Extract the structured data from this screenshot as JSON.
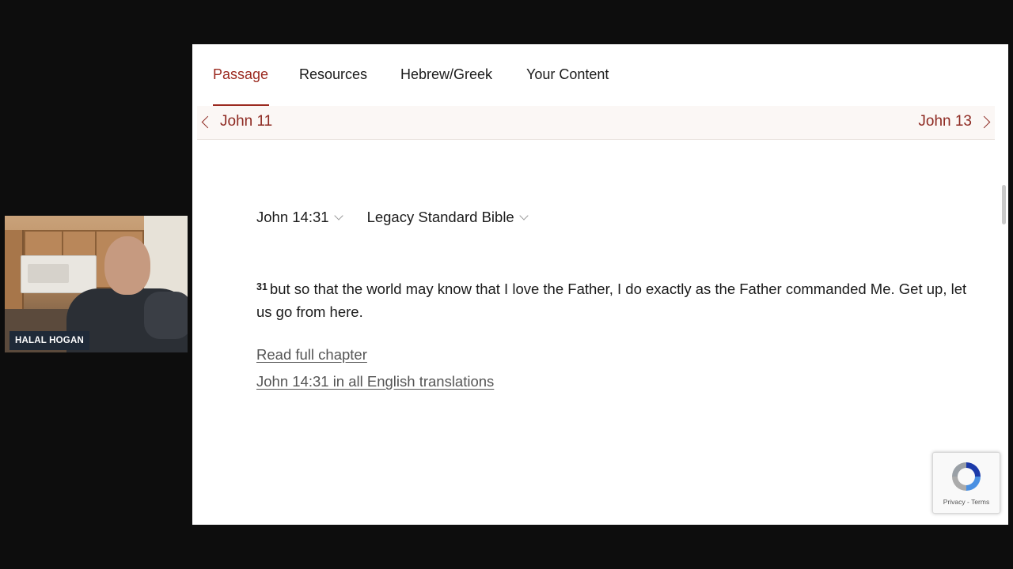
{
  "webcam": {
    "name_tag": "HALAL HOGAN"
  },
  "tabs": [
    {
      "label": "Passage",
      "active": true
    },
    {
      "label": "Resources",
      "active": false
    },
    {
      "label": "Hebrew/Greek",
      "active": false
    },
    {
      "label": "Your Content",
      "active": false
    }
  ],
  "chapter_nav": {
    "prev": "John 11",
    "next": "John 13"
  },
  "reference_select": "John 14:31",
  "version_select": "Legacy Standard Bible",
  "verse": {
    "number": "31",
    "text": "but so that the world may know that I love the Father, I do exactly as the Father commanded Me. Get up, let us go from here."
  },
  "links": {
    "read_full_chapter": "Read full chapter",
    "all_translations": "John 14:31 in all English translations"
  },
  "recaptcha": {
    "footer": "Privacy - Terms"
  },
  "colors": {
    "accent": "#9b2a20",
    "background": "#0d0d0d",
    "panel": "#ffffff"
  }
}
